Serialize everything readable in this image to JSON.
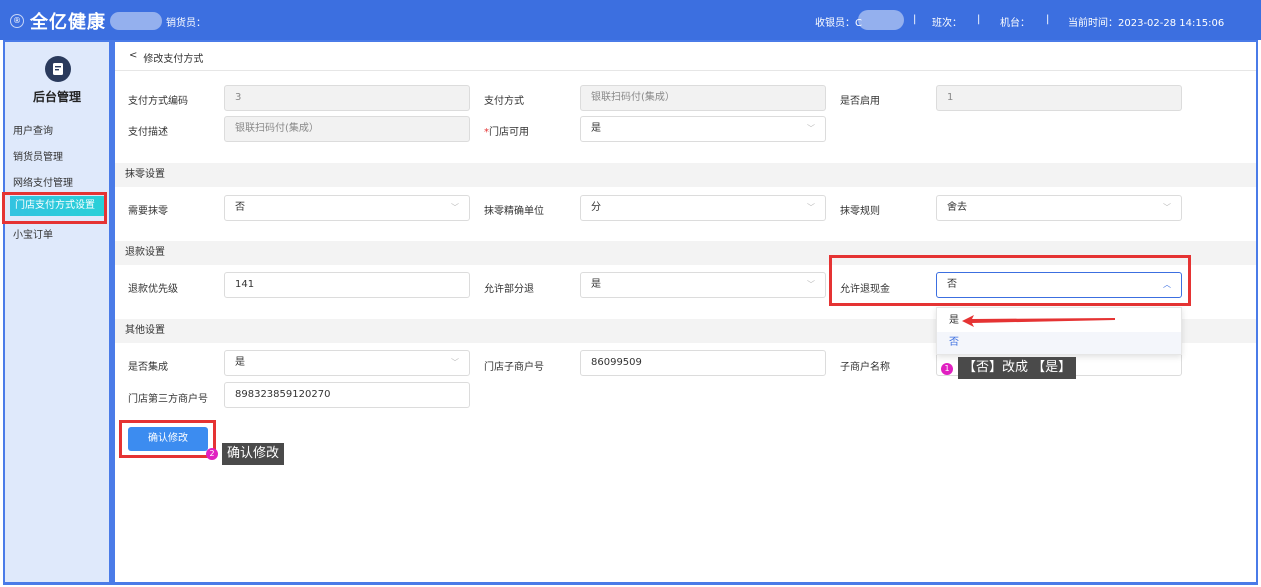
{
  "topbar": {
    "brand": "全亿健康",
    "seller_label": "销货员：",
    "cashier_label": "收银员：C",
    "shift_label": "班次：",
    "terminal_label": "机台：",
    "sep": "|",
    "time_label": "当前时间：2023-02-28 14:15:06"
  },
  "sidebar": {
    "title": "后台管理",
    "items": [
      {
        "label": "用户查询"
      },
      {
        "label": "销货员管理"
      },
      {
        "label": "网络支付管理"
      },
      {
        "label": "门店支付方式设置"
      },
      {
        "label": "小宝订单"
      }
    ]
  },
  "page": {
    "back_label": "修改支付方式"
  },
  "basic": {
    "code_label": "支付方式编码",
    "code_value": "3",
    "method_label": "支付方式",
    "method_value": "银联扫码付(集成）",
    "enabled_label": "是否启用",
    "enabled_value": "1",
    "desc_label": "支付描述",
    "desc_value": "银联扫码付(集成）",
    "store_avail_label": "门店可用",
    "store_avail_required": "*",
    "store_avail_value": "是"
  },
  "rounding": {
    "section": "抹零设置",
    "need_label": "需要抹零",
    "need_value": "否",
    "unit_label": "抹零精确单位",
    "unit_value": "分",
    "rule_label": "抹零规则",
    "rule_value": "舍去"
  },
  "refund": {
    "section": "退款设置",
    "priority_label": "退款优先级",
    "priority_value": "141",
    "partial_label": "允许部分退",
    "partial_value": "是",
    "cash_label": "允许退现金",
    "cash_value": "否",
    "options": [
      "是",
      "否"
    ]
  },
  "other": {
    "section": "其他设置",
    "integrated_label": "是否集成",
    "integrated_value": "是",
    "submerchant_label": "门店子商户号",
    "submerchant_value": "86099509",
    "submerchant_name_label": "子商户名称",
    "third_party_label": "门店第三方商户号",
    "third_party_value": "898323859120270"
  },
  "actions": {
    "confirm_label": "确认修改"
  },
  "annotations": {
    "step1_num": "1",
    "step1_text": "【否】改成 【是】",
    "step2_num": "2",
    "step2_text": "确认修改"
  },
  "colors": {
    "topbar": "#3c6fe0",
    "accent": "#3c8cf0",
    "highlight_box": "#e53333",
    "badge": "#e020c0"
  }
}
